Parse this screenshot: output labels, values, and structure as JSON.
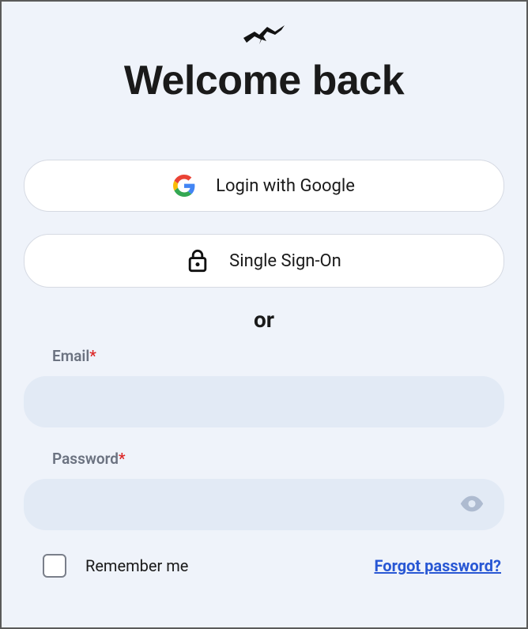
{
  "header": {
    "title": "Welcome back"
  },
  "sso": {
    "google_label": "Login with Google",
    "single_label": "Single Sign-On"
  },
  "divider": {
    "text": "or"
  },
  "form": {
    "email_label": "Email",
    "email_value": "",
    "password_label": "Password",
    "password_value": "",
    "required_mark": "*"
  },
  "footer": {
    "remember_label": "Remember me",
    "forgot_label": "Forgot password?"
  }
}
